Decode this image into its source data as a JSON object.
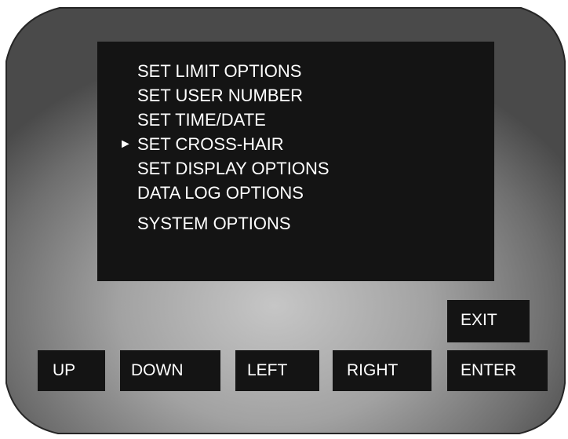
{
  "menu": {
    "items": [
      {
        "label": "SET LIMIT OPTIONS",
        "selected": false
      },
      {
        "label": "SET USER NUMBER",
        "selected": false
      },
      {
        "label": "SET TIME/DATE",
        "selected": false
      },
      {
        "label": "SET CROSS-HAIR",
        "selected": true
      },
      {
        "label": "SET DISPLAY OPTIONS",
        "selected": false
      },
      {
        "label": "DATA LOG OPTIONS",
        "selected": false
      },
      {
        "label": "SYSTEM OPTIONS",
        "selected": false
      }
    ],
    "cursor_glyph": "►"
  },
  "keys": {
    "exit": "EXIT",
    "up": "UP",
    "down": "DOWN",
    "left": "LEFT",
    "right": "RIGHT",
    "enter": "ENTER"
  },
  "colors": {
    "screen": "#141414",
    "text": "#ffffff",
    "bezel_center": "#c4c4c4",
    "bezel_edge": "#4a4a4a"
  },
  "icons": {
    "selection_cursor": "right-pointer-triangle"
  }
}
